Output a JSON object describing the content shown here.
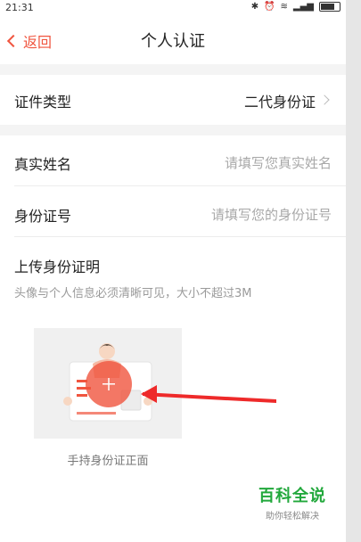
{
  "status": {
    "time": "21:31"
  },
  "nav": {
    "back_label": "返回",
    "title": "个人认证"
  },
  "form": {
    "id_type": {
      "label": "证件类型",
      "value": "二代身份证"
    },
    "real_name": {
      "label": "真实姓名",
      "placeholder": "请填写您真实姓名"
    },
    "id_number": {
      "label": "身份证号",
      "placeholder": "请填写您的身份证号"
    },
    "upload": {
      "heading": "上传身份证明",
      "hint": "头像与个人信息必须清晰可见，大小不超过3M",
      "card_caption": "手持身份证正面"
    }
  },
  "watermark": {
    "name": "百科全说",
    "slogan": "助你轻松解决"
  },
  "colors": {
    "accent": "#f0553f",
    "brand_green": "#22a83c"
  }
}
